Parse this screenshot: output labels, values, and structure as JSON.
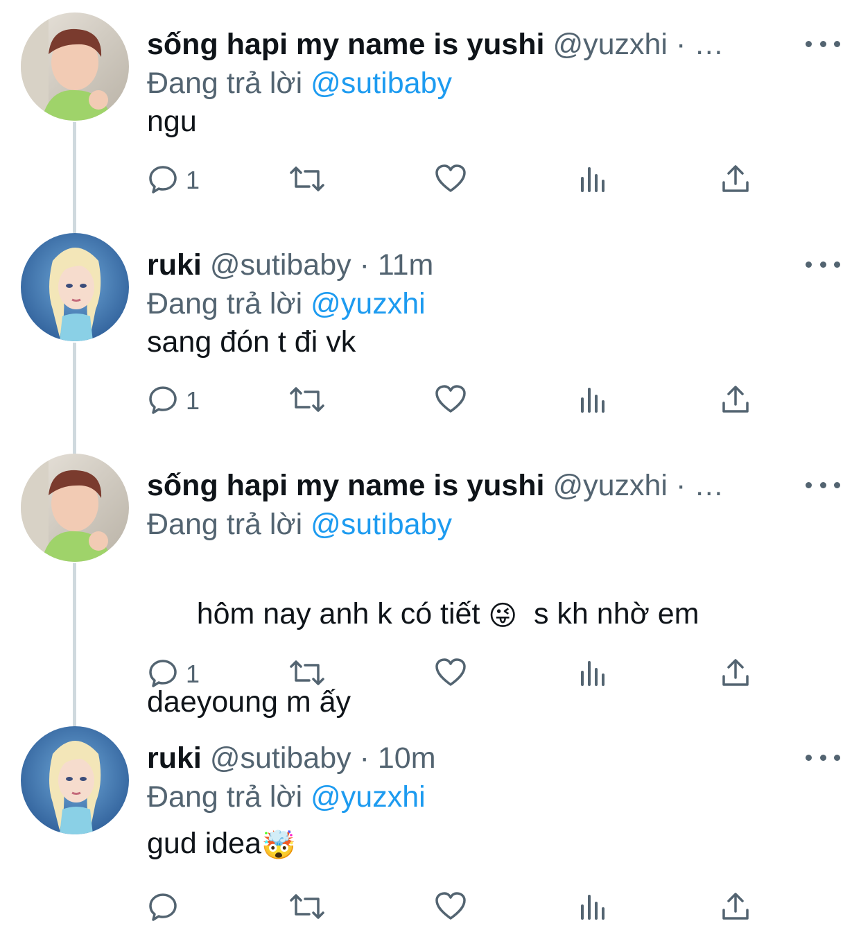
{
  "tweets": [
    {
      "name": "sống hapi my name is yushi",
      "handle": "@yuzxhi",
      "separator": "·",
      "time": "…",
      "reply_prefix": "Đang trả lời",
      "reply_mention": "@sutibaby",
      "text_lines": [
        "ngu"
      ],
      "reply_count": "1",
      "avatar": "yushi-avatar"
    },
    {
      "name": "ruki",
      "handle": "@sutibaby",
      "separator": "·",
      "time": "11m",
      "reply_prefix": "Đang trả lời",
      "reply_mention": "@yuzxhi",
      "text_lines": [
        "sang đón t đi vk"
      ],
      "reply_count": "1",
      "avatar": "elsa-avatar"
    },
    {
      "name": "sống hapi my name is yushi",
      "handle": "@yuzxhi",
      "separator": "·",
      "time": "…",
      "reply_prefix": "Đang trả lời",
      "reply_mention": "@sutibaby",
      "text_part1": "hôm nay anh k có tiết ",
      "text_emoji": "😜",
      "text_part2": "  s kh nhờ em",
      "text_line2": "daeyoung m ấy",
      "reply_count": "1",
      "avatar": "yushi-avatar"
    },
    {
      "name": "ruki",
      "handle": "@sutibaby",
      "separator": "·",
      "time": "10m",
      "reply_prefix": "Đang trả lời",
      "reply_mention": "@yuzxhi",
      "text_part1": "gud idea",
      "text_emoji": "🤯",
      "reply_count": "",
      "avatar": "elsa-avatar"
    }
  ],
  "icons": {
    "reply": "reply-icon",
    "retweet": "retweet-icon",
    "like": "heart-icon",
    "views": "views-icon",
    "share": "share-icon",
    "more": "more-icon"
  },
  "colors": {
    "text": "#0f1419",
    "secondary": "#536471",
    "link": "#1d9bf0",
    "thread_line": "#cfd9de"
  }
}
